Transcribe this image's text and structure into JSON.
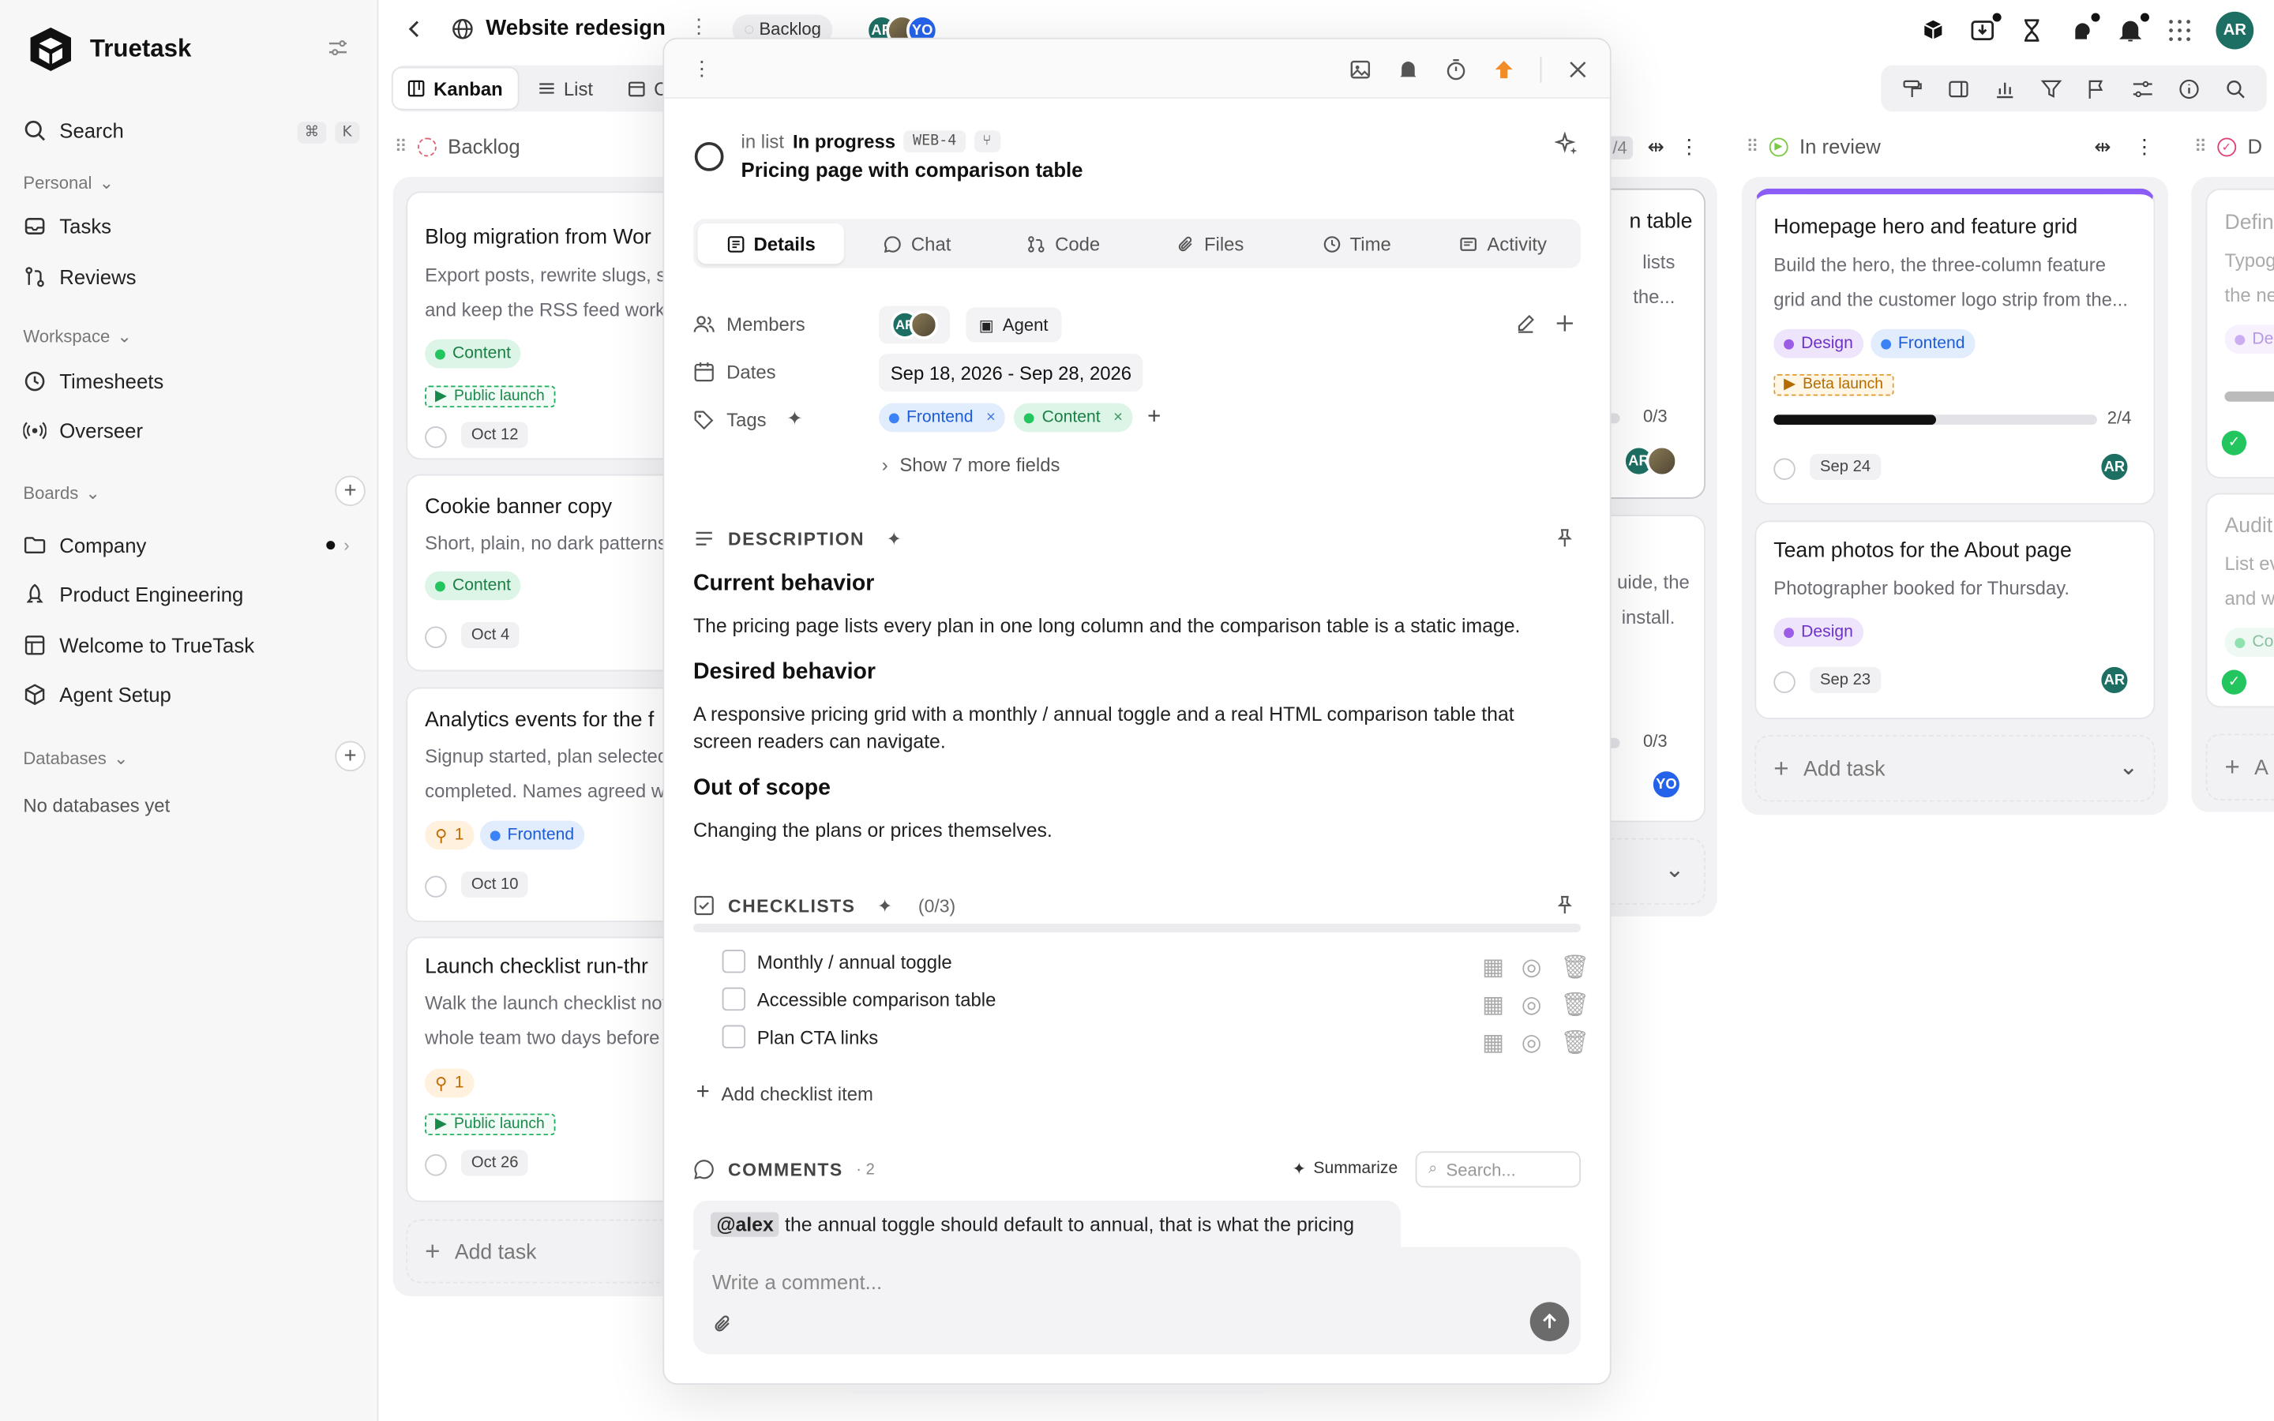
{
  "sidebar": {
    "brand": "Truetask",
    "search": {
      "label": "Search",
      "kbd": [
        "⌘",
        "K"
      ]
    },
    "personal_header": "Personal",
    "personal_items": [
      {
        "label": "Tasks",
        "icon": "tasks-icon"
      },
      {
        "label": "Reviews",
        "icon": "reviews-icon"
      }
    ],
    "workspace_header": "Workspace",
    "workspace_items": [
      {
        "label": "Timesheets",
        "icon": "timesheets-icon"
      },
      {
        "label": "Overseer",
        "icon": "overseer-icon"
      }
    ],
    "boards_header": "Boards",
    "boards": [
      {
        "label": "Company",
        "icon": "folder-icon"
      },
      {
        "label": "Product Engineering",
        "icon": "rocket-icon"
      },
      {
        "label": "Welcome to TrueTask",
        "icon": "board-icon"
      },
      {
        "label": "Agent Setup",
        "icon": "cube-icon"
      }
    ],
    "databases_header": "Databases",
    "databases_empty": "No databases yet"
  },
  "topbar": {
    "project": "Website redesign",
    "status_pill": "Backlog",
    "avatars": [
      "AR",
      "",
      "YO"
    ],
    "me": "AR"
  },
  "view_tabs": [
    {
      "label": "Kanban",
      "active": true
    },
    {
      "label": "List"
    },
    {
      "label": "Ca"
    }
  ],
  "columns": {
    "backlog": {
      "title": "Backlog",
      "cards": [
        {
          "title": "Blog migration from Wor",
          "desc": [
            "Export posts, rewrite slugs, se",
            "and keep the RSS feed workin"
          ],
          "tags": [
            "Content"
          ],
          "launch": "Public launch",
          "date": "Oct 12"
        },
        {
          "title": "Cookie banner copy",
          "desc": [
            "Short, plain, no dark patterns."
          ],
          "tags": [
            "Content"
          ],
          "date": "Oct 4"
        },
        {
          "title": "Analytics events for the f",
          "desc": [
            "Signup started, plan selected",
            "completed. Names agreed w"
          ],
          "link_count": "1",
          "tags": [
            "Frontend"
          ],
          "date": "Oct 10"
        },
        {
          "title": "Launch checklist run-thr",
          "desc": [
            "Walk the launch checklist not",
            "whole team two days before t"
          ],
          "link_count": "1",
          "launch": "Public launch",
          "date": "Oct 26"
        }
      ],
      "add_task": "Add task"
    },
    "in_progress_partial": {
      "count_frag": "/4",
      "card1": {
        "title_frag": "n table",
        "desc": [
          "lists",
          "the..."
        ],
        "progress": "0/3",
        "progress_value": 0.0,
        "avatar": "AR"
      },
      "card2": {
        "desc": [
          "uide, the",
          "install."
        ],
        "progress": "0/3",
        "progress_value": 0.0,
        "avatar": "YO"
      }
    },
    "in_review": {
      "title": "In review",
      "cards": [
        {
          "title": "Homepage hero and feature grid",
          "desc": [
            "Build the hero, the three-column feature",
            "grid and the customer logo strip from the..."
          ],
          "tags": [
            "Design",
            "Frontend"
          ],
          "launch": "Beta launch",
          "progress": "2/4",
          "progress_value": 0.5,
          "date": "Sep 24",
          "avatar": "AR"
        },
        {
          "title": "Team photos for the About page",
          "desc": [
            "Photographer booked for Thursday."
          ],
          "tags": [
            "Design"
          ],
          "date": "Sep 23",
          "avatar": "AR"
        }
      ],
      "add_task": "Add task"
    },
    "done_partial": {
      "title_frag": "D",
      "card1": {
        "title_frag": "Defin",
        "desc": [
          "Typog",
          "the ne"
        ],
        "tag_frag": "Des"
      },
      "card2": {
        "title_frag": "Audit",
        "desc": [
          "List ev",
          "and w"
        ],
        "tag_frag": "Cor"
      },
      "add_frag": "A"
    }
  },
  "modal": {
    "in_list_prefix": "in list",
    "list_name": "In progress",
    "code": "WEB-4",
    "title": "Pricing page with comparison table",
    "tabs": [
      {
        "label": "Details",
        "icon": "details-icon",
        "active": true
      },
      {
        "label": "Chat",
        "icon": "chat-icon"
      },
      {
        "label": "Code",
        "icon": "code-icon"
      },
      {
        "label": "Files",
        "icon": "paperclip-icon"
      },
      {
        "label": "Time",
        "icon": "clock-icon"
      },
      {
        "label": "Activity",
        "icon": "activity-icon"
      }
    ],
    "fields": {
      "members_label": "Members",
      "member_avatar": "AR",
      "agent": "Agent",
      "dates_label": "Dates",
      "dates": "Sep 18, 2026 - Sep 28, 2026",
      "tags_label": "Tags",
      "tags": [
        "Frontend",
        "Content"
      ],
      "more_fields": "Show 7 more fields"
    },
    "description": {
      "header": "DESCRIPTION",
      "h1": "Current behavior",
      "p1": "The pricing page lists every plan in one long column and the comparison table is a static image.",
      "h2": "Desired behavior",
      "p2": "A responsive pricing grid with a monthly / annual toggle and a real HTML comparison table that screen readers can navigate.",
      "h3": "Out of scope",
      "p3": "Changing the plans or prices themselves."
    },
    "checklists": {
      "header": "CHECKLISTS",
      "count": "(0/3)",
      "items": [
        "Monthly / annual toggle",
        "Accessible comparison table",
        "Plan CTA links"
      ],
      "add": "Add checklist item"
    },
    "comments": {
      "header": "COMMENTS",
      "count": "· 2",
      "summarize": "Summarize",
      "search_placeholder": "Search...",
      "first_mention": "@alex",
      "first_text": "the annual toggle should default to annual, that is what the pricing",
      "composer_placeholder": "Write a comment..."
    }
  },
  "colors": {
    "accent_teal": "#1e6f63",
    "accent_blue": "#2563eb",
    "in_review_bar": "#8b5cf6",
    "priority_orange": "#f28c28"
  }
}
